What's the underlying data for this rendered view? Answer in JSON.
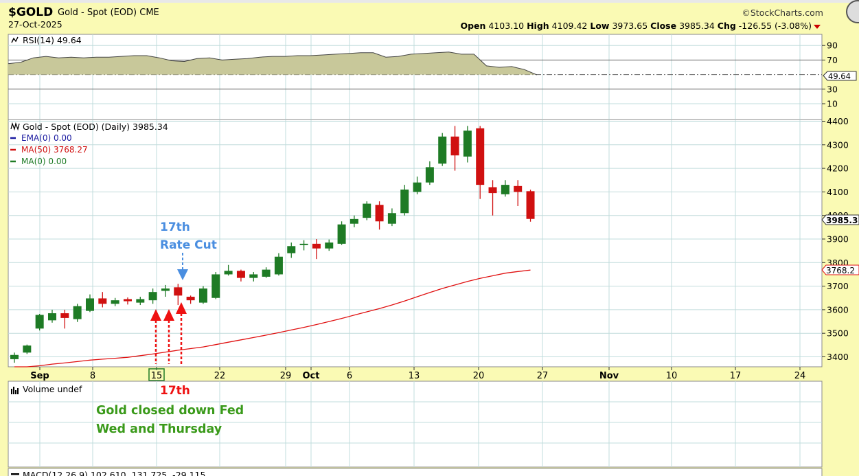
{
  "header": {
    "symbol": "$GOLD",
    "description": "Gold - Spot (EOD) CME",
    "date": "27-Oct-2025",
    "credit": "©StockCharts.com",
    "open_label": "Open",
    "open": "4103.10",
    "high_label": "High",
    "high": "4109.42",
    "low_label": "Low",
    "low": "3973.65",
    "close_label": "Close",
    "close": "3985.34",
    "chg_label": "Chg",
    "chg": "-126.55 (-3.08%)"
  },
  "colors": {
    "background": "#fafab4",
    "panel": "#ffffff",
    "grid": "#c0dcdc",
    "up": "#1e7b25",
    "down": "#d01010",
    "ma50": "#e01010",
    "rsi_fill": "#c8c89a",
    "rsi_line": "#444444",
    "annotation_blue": "#4a8ee0",
    "annotation_red": "#ee1111",
    "annotation_green": "#3a9a1a"
  },
  "rsi_panel": {
    "label": "RSI(14) 49.64",
    "current_tag": "49.64",
    "ticks": [
      "90",
      "70",
      "30",
      "10"
    ]
  },
  "price_panel": {
    "label": "Gold - Spot (EOD) (Daily) 3985.34",
    "legend": [
      {
        "text": "EMA(0) 0.00",
        "color": "#1a1aa0"
      },
      {
        "text": "MA(50) 3768.27",
        "color": "#d01010"
      },
      {
        "text": "MA(0) 0.00",
        "color": "#1e7b25"
      }
    ],
    "y_ticks": [
      "4400",
      "4300",
      "4200",
      "4100",
      "4000",
      "3900",
      "3800",
      "3700",
      "3600",
      "3500",
      "3400"
    ],
    "close_tag": "3985.3",
    "ma_tag": "3768.2"
  },
  "x_axis": {
    "labels": [
      "Sep",
      "8",
      "15",
      "22",
      "29",
      "Oct",
      "6",
      "13",
      "20",
      "27",
      "Nov",
      "10",
      "17",
      "24"
    ],
    "bold_labels": [
      "Sep",
      "Oct",
      "Nov"
    ],
    "highlighted": "15"
  },
  "volume_panel": {
    "label": "Volume undef"
  },
  "macd_panel": {
    "label": "MACD(12,26,9) 102.610, 131.725, -29.115"
  },
  "annotations": {
    "rate_cut_line1": "17th",
    "rate_cut_line2": "Rate Cut",
    "red_label": "17th",
    "note_line1": "Gold closed down Fed",
    "note_line2": "Wed and Thursday"
  },
  "chart_data": {
    "type": "candlestick",
    "title": "Gold - Spot (EOD) (Daily)",
    "ylim": [
      3360,
      4420
    ],
    "series": [
      {
        "date": "2025-09-01",
        "open": 3390,
        "high": 3418,
        "low": 3375,
        "close": 3408
      },
      {
        "date": "2025-09-02",
        "open": 3418,
        "high": 3452,
        "low": 3412,
        "close": 3448
      },
      {
        "date": "2025-09-03",
        "open": 3520,
        "high": 3582,
        "low": 3512,
        "close": 3578
      },
      {
        "date": "2025-09-04",
        "open": 3555,
        "high": 3600,
        "low": 3545,
        "close": 3585
      },
      {
        "date": "2025-09-05",
        "open": 3585,
        "high": 3600,
        "low": 3520,
        "close": 3565
      },
      {
        "date": "2025-09-08",
        "open": 3560,
        "high": 3625,
        "low": 3548,
        "close": 3615
      },
      {
        "date": "2025-09-09",
        "open": 3595,
        "high": 3665,
        "low": 3590,
        "close": 3648
      },
      {
        "date": "2025-09-10",
        "open": 3648,
        "high": 3675,
        "low": 3610,
        "close": 3625
      },
      {
        "date": "2025-09-11",
        "open": 3625,
        "high": 3650,
        "low": 3615,
        "close": 3640
      },
      {
        "date": "2025-09-12",
        "open": 3645,
        "high": 3652,
        "low": 3622,
        "close": 3636
      },
      {
        "date": "2025-09-15",
        "open": 3630,
        "high": 3655,
        "low": 3620,
        "close": 3645
      },
      {
        "date": "2025-09-16",
        "open": 3640,
        "high": 3690,
        "low": 3625,
        "close": 3675
      },
      {
        "date": "2025-09-17",
        "open": 3680,
        "high": 3705,
        "low": 3655,
        "close": 3690
      },
      {
        "date": "2025-09-18",
        "open": 3695,
        "high": 3710,
        "low": 3620,
        "close": 3660
      },
      {
        "date": "2025-09-19",
        "open": 3655,
        "high": 3660,
        "low": 3625,
        "close": 3640
      },
      {
        "date": "2025-09-22",
        "open": 3630,
        "high": 3700,
        "low": 3625,
        "close": 3690
      },
      {
        "date": "2025-09-23",
        "open": 3650,
        "high": 3760,
        "low": 3645,
        "close": 3750
      },
      {
        "date": "2025-09-24",
        "open": 3750,
        "high": 3790,
        "low": 3745,
        "close": 3765
      },
      {
        "date": "2025-09-25",
        "open": 3765,
        "high": 3770,
        "low": 3720,
        "close": 3735
      },
      {
        "date": "2025-09-26",
        "open": 3735,
        "high": 3760,
        "low": 3720,
        "close": 3750
      },
      {
        "date": "2025-09-29",
        "open": 3740,
        "high": 3780,
        "low": 3735,
        "close": 3770
      },
      {
        "date": "2025-09-30",
        "open": 3750,
        "high": 3840,
        "low": 3745,
        "close": 3825
      },
      {
        "date": "2025-10-01",
        "open": 3840,
        "high": 3885,
        "low": 3820,
        "close": 3870
      },
      {
        "date": "2025-10-02",
        "open": 3875,
        "high": 3895,
        "low": 3852,
        "close": 3880
      },
      {
        "date": "2025-10-03",
        "open": 3880,
        "high": 3900,
        "low": 3815,
        "close": 3860
      },
      {
        "date": "2025-10-06",
        "open": 3860,
        "high": 3898,
        "low": 3850,
        "close": 3885
      },
      {
        "date": "2025-10-07",
        "open": 3880,
        "high": 3975,
        "low": 3875,
        "close": 3962
      },
      {
        "date": "2025-10-08",
        "open": 3965,
        "high": 4000,
        "low": 3950,
        "close": 3985
      },
      {
        "date": "2025-10-09",
        "open": 3990,
        "high": 4060,
        "low": 3980,
        "close": 4050
      },
      {
        "date": "2025-10-10",
        "open": 4045,
        "high": 4060,
        "low": 3940,
        "close": 3975
      },
      {
        "date": "2025-10-13",
        "open": 3965,
        "high": 4030,
        "low": 3955,
        "close": 4010
      },
      {
        "date": "2025-10-14",
        "open": 4010,
        "high": 4130,
        "low": 4000,
        "close": 4110
      },
      {
        "date": "2025-10-15",
        "open": 4100,
        "high": 4165,
        "low": 4090,
        "close": 4140
      },
      {
        "date": "2025-10-16",
        "open": 4140,
        "high": 4230,
        "low": 4130,
        "close": 4205
      },
      {
        "date": "2025-10-17",
        "open": 4220,
        "high": 4350,
        "low": 4210,
        "close": 4335
      },
      {
        "date": "2025-10-20",
        "open": 4335,
        "high": 4380,
        "low": 4190,
        "close": 4255
      },
      {
        "date": "2025-10-21",
        "open": 4250,
        "high": 4380,
        "low": 4225,
        "close": 4360
      },
      {
        "date": "2025-10-22",
        "open": 4370,
        "high": 4380,
        "low": 4070,
        "close": 4130
      },
      {
        "date": "2025-10-23",
        "open": 4120,
        "high": 4150,
        "low": 4000,
        "close": 4095
      },
      {
        "date": "2025-10-24",
        "open": 4090,
        "high": 4150,
        "low": 4080,
        "close": 4130
      },
      {
        "date": "2025-10-27",
        "open": 4125,
        "high": 4150,
        "low": 4040,
        "close": 4100
      },
      {
        "date": "2025-10-28",
        "open": 4103.1,
        "high": 4109.42,
        "low": 3973.65,
        "close": 3985.34
      }
    ],
    "ma50": [
      3350,
      3355,
      3362,
      3369,
      3374,
      3380,
      3386,
      3390,
      3394,
      3398,
      3405,
      3412,
      3420,
      3428,
      3435,
      3442,
      3452,
      3462,
      3472,
      3482,
      3492,
      3503,
      3514,
      3525,
      3537,
      3550,
      3563,
      3577,
      3591,
      3605,
      3620,
      3637,
      3655,
      3673,
      3690,
      3705,
      3720,
      3733,
      3744,
      3755,
      3762,
      3768.27
    ],
    "rsi": [
      65,
      67,
      73,
      75,
      73,
      74,
      73,
      74,
      74,
      75,
      76,
      76,
      73,
      69,
      68,
      72,
      73,
      70,
      71,
      72,
      74,
      75,
      75,
      76,
      76,
      77,
      78,
      79,
      80,
      80,
      74,
      75,
      78,
      79,
      80,
      81,
      78,
      78,
      62,
      60,
      61,
      57,
      49.64
    ]
  }
}
